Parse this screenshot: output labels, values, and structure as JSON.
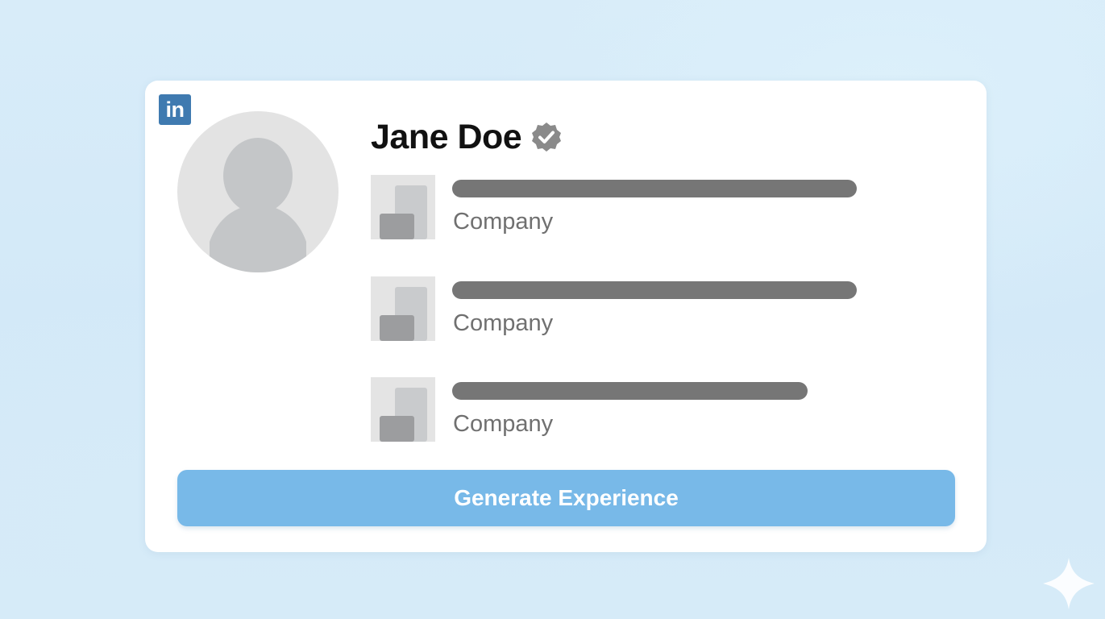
{
  "profile": {
    "logo_text": "in",
    "name": "Jane Doe",
    "verified_icon": "verified-badge-icon"
  },
  "experience": [
    {
      "company": "Company"
    },
    {
      "company": "Company"
    },
    {
      "company": "Company"
    }
  ],
  "actions": {
    "generate_label": "Generate Experience"
  },
  "colors": {
    "background": "#d6ebf8",
    "card": "#ffffff",
    "button": "#78b9e8",
    "linkedin_blue": "#3f7ab0",
    "placeholder_bar": "#767676",
    "company_text": "#707070"
  }
}
